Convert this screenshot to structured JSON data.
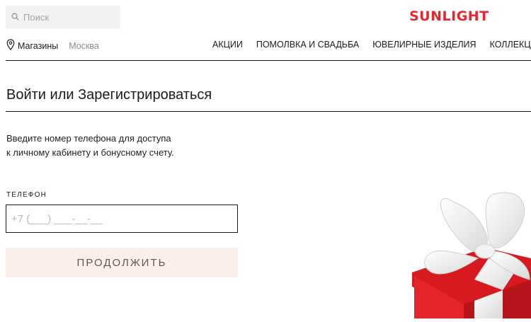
{
  "search": {
    "placeholder": "Поиск"
  },
  "logo": {
    "text": "SUNLIGHT",
    "color": "#e8252c"
  },
  "location": {
    "stores_label": "Магазины",
    "city": "Москва"
  },
  "nav": {
    "items": [
      {
        "label": "АКЦИИ"
      },
      {
        "label": "ПОМОЛВКА И СВАДЬБА"
      },
      {
        "label": "ЮВЕЛИРНЫЕ ИЗДЕЛИЯ"
      },
      {
        "label": "КОЛЛЕКЦИИ"
      }
    ]
  },
  "login": {
    "title": "Войти или Зарегистрироваться",
    "description_line1": "Введите номер телефона для доступа",
    "description_line2": "к личному кабинету и бонусному счету.",
    "phone_label": "ТЕЛЕФОН",
    "phone_placeholder": "+7 (___) ___-__-__",
    "phone_value": "",
    "continue_label": "ПРОДОЛЖИТЬ"
  },
  "colors": {
    "accent": "#e8252c",
    "button_bg": "#fcefe9",
    "text": "#1a1a1a"
  },
  "icons": {
    "search": "search-icon",
    "location": "map-pin-icon",
    "gift": "gift-box-image"
  }
}
